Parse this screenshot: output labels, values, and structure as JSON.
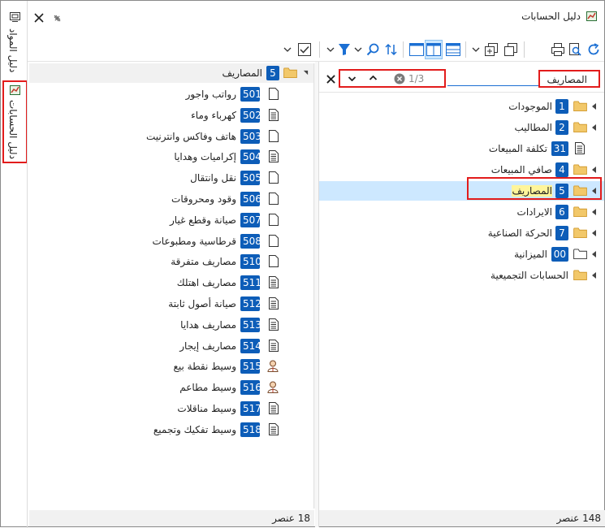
{
  "side_tabs": [
    {
      "label": "دليل المواد",
      "icon": "tree-icon"
    },
    {
      "label": "دليل الحسابات",
      "icon": "chart-icon"
    }
  ],
  "window": {
    "title": "دليل الحسابات"
  },
  "search": {
    "value": "المصاريف",
    "counter": "1/3"
  },
  "tree": [
    {
      "badge": "1",
      "label": "الموجودات",
      "icon": "folder",
      "expand": true
    },
    {
      "badge": "2",
      "label": "المطاليب",
      "icon": "folder",
      "expand": true
    },
    {
      "badge": "31",
      "label": "تكلفة المبيعات",
      "icon": "document",
      "expand": false
    },
    {
      "badge": "4",
      "label": "صافي المبيعات",
      "icon": "folder",
      "expand": true
    },
    {
      "badge": "5",
      "label": "المصاريف",
      "icon": "folder",
      "expand": true,
      "selected": true
    },
    {
      "badge": "6",
      "label": "الايرادات",
      "icon": "folder",
      "expand": true
    },
    {
      "badge": "7",
      "label": "الحركة الصناعية",
      "icon": "folder",
      "expand": true
    },
    {
      "badge": "00",
      "label": "الميزانية",
      "icon": "folder-outline",
      "expand": true
    },
    {
      "badge": "",
      "label": "الحسابات التجميعية",
      "icon": "folder",
      "expand": true
    }
  ],
  "left_status": "148 عنصر",
  "detail_header": {
    "badge": "5",
    "label": "المصاريف"
  },
  "detail_items": [
    {
      "badge": "501",
      "label": "رواتب واجور",
      "icon": "blank"
    },
    {
      "badge": "502",
      "label": "كهرباء وماء",
      "icon": "lines"
    },
    {
      "badge": "503",
      "label": "هاتف وفاكس وانترنيت",
      "icon": "blank"
    },
    {
      "badge": "504",
      "label": "إكراميات وهدايا",
      "icon": "lines"
    },
    {
      "badge": "505",
      "label": "نقل وانتقال",
      "icon": "blank"
    },
    {
      "badge": "506",
      "label": "وقود ومحروقات",
      "icon": "blank"
    },
    {
      "badge": "507",
      "label": "صيانة وقطع غيار",
      "icon": "blank"
    },
    {
      "badge": "508",
      "label": "قرطاسية ومطبوعات",
      "icon": "blank"
    },
    {
      "badge": "510",
      "label": "مصاريف متفرقة",
      "icon": "blank"
    },
    {
      "badge": "511",
      "label": "مصاريف اهتلك",
      "icon": "lines"
    },
    {
      "badge": "512",
      "label": "صيانة أصول ثابتة",
      "icon": "lines"
    },
    {
      "badge": "513",
      "label": "مصاريف هدايا",
      "icon": "lines"
    },
    {
      "badge": "514",
      "label": "مصاريف إيجار",
      "icon": "lines"
    },
    {
      "badge": "515",
      "label": "وسيط نقطة بيع",
      "icon": "person"
    },
    {
      "badge": "516",
      "label": "وسيط مطاعم",
      "icon": "person"
    },
    {
      "badge": "517",
      "label": "وسيط مناقلات",
      "icon": "lines"
    },
    {
      "badge": "518",
      "label": "وسيط تفكيك وتجميع",
      "icon": "lines"
    }
  ],
  "right_status": "18 عنصر",
  "colors": {
    "badge": "#0d5db8",
    "selection": "#cde8ff",
    "highlight": "#fff59a",
    "annotation": "#e21c1c",
    "folder": "#f2c86a"
  }
}
